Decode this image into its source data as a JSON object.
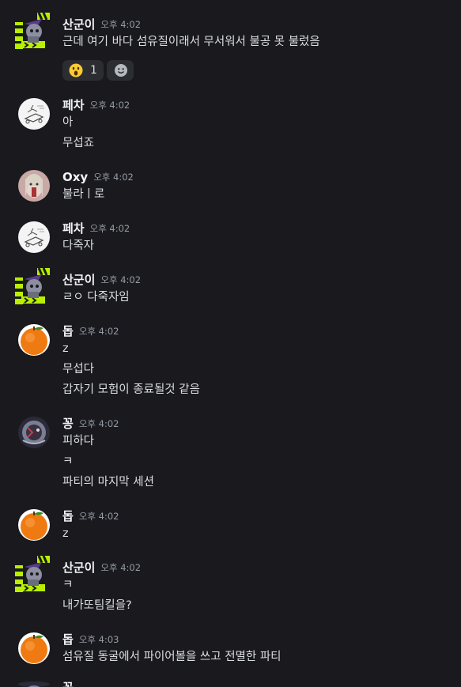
{
  "messages": [
    {
      "user": "산군이",
      "time": "오후 4:02",
      "lines": [
        "근데 여기 바다 섬유질이래서 무서워서 불공 못 불렀음"
      ],
      "reactions": [
        {
          "emoji": "astonished-face-icon",
          "count": "1"
        }
      ]
    },
    {
      "user": "페차",
      "time": "오후 4:02",
      "lines": [
        "아",
        "무섭죠"
      ]
    },
    {
      "user": "Oxy",
      "time": "오후 4:02",
      "lines": [
        "불라ㅣ로"
      ]
    },
    {
      "user": "페차",
      "time": "오후 4:02",
      "lines": [
        "다죽자"
      ]
    },
    {
      "user": "산군이",
      "time": "오후 4:02",
      "lines": [
        "ㄹㅇ 다죽자임"
      ]
    },
    {
      "user": "돕",
      "time": "오후 4:02",
      "lines": [
        "z",
        "무섭다",
        "갑자기 모험이 종료될것 같음"
      ]
    },
    {
      "user": "꽁",
      "time": "오후 4:02",
      "lines": [
        "피하다",
        "ㅋ",
        "파티의 마지막 세션"
      ]
    },
    {
      "user": "돕",
      "time": "오후 4:02",
      "lines": [
        "z"
      ]
    },
    {
      "user": "산군이",
      "time": "오후 4:02",
      "lines": [
        "ㅋ",
        "내가또팀킬을?"
      ]
    },
    {
      "user": "돕",
      "time": "오후 4:03",
      "lines": [
        "섬유질 동굴에서 파이어볼을 쓰고 전멸한 파티"
      ]
    },
    {
      "user": "꽁",
      "time": "",
      "lines": []
    }
  ],
  "colors": {
    "background": "#1a1a1e",
    "username": "#f2f3f5",
    "timestamp": "#949ba4",
    "text": "#dbdee1",
    "reaction_bg": "#2b2d31"
  }
}
